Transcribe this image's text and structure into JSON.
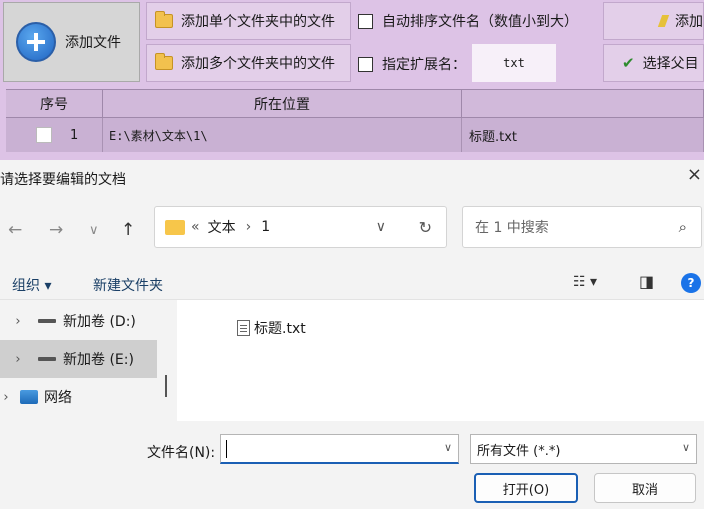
{
  "app": {
    "add_file_label": "添加文件",
    "add_single_folder_label": "添加单个文件夹中的文件",
    "add_multi_folder_label": "添加多个文件夹中的文件",
    "auto_sort_label": "自动排序文件名（数值小到大）",
    "ext_label": "指定扩展名：",
    "ext_value": "txt",
    "right_top_label": "添加",
    "right_bottom_label": "选择父目",
    "grid": {
      "headers": [
        "序号",
        "所在位置",
        ""
      ],
      "rows": [
        {
          "index": "1",
          "location": "E:\\素材\\文本\\1\\",
          "name": "标题.txt"
        }
      ]
    }
  },
  "dialog": {
    "title": "请选择要编辑的文档",
    "close": "×",
    "nav": {
      "back": "←",
      "forward": "→",
      "recent": "∨",
      "up": "↑"
    },
    "path_prefix": "«",
    "path_folder": "文本",
    "path_sep": "›",
    "path_current": "1",
    "path_dropdown": "∨",
    "refresh": "↻",
    "search_placeholder": "在 1 中搜索",
    "search_icon": "⌕",
    "organize_label": "组织 ▾",
    "new_folder_label": "新建文件夹",
    "view_icon": "☷ ▾",
    "pane_icon": "◨",
    "help_icon": "?",
    "tree": [
      {
        "arrow": "›",
        "label": "新加卷 (D:)"
      },
      {
        "arrow": "›",
        "label": "新加卷 (E:)"
      },
      {
        "arrow": "›",
        "label": "网络"
      }
    ],
    "files": [
      {
        "name": "标题.txt"
      }
    ],
    "filename_label": "文件名(N):",
    "filename_value": "",
    "filetype_value": "所有文件 (*.*)",
    "dropdown_icon": "∨",
    "open_label": "打开(O)",
    "cancel_label": "取消"
  }
}
